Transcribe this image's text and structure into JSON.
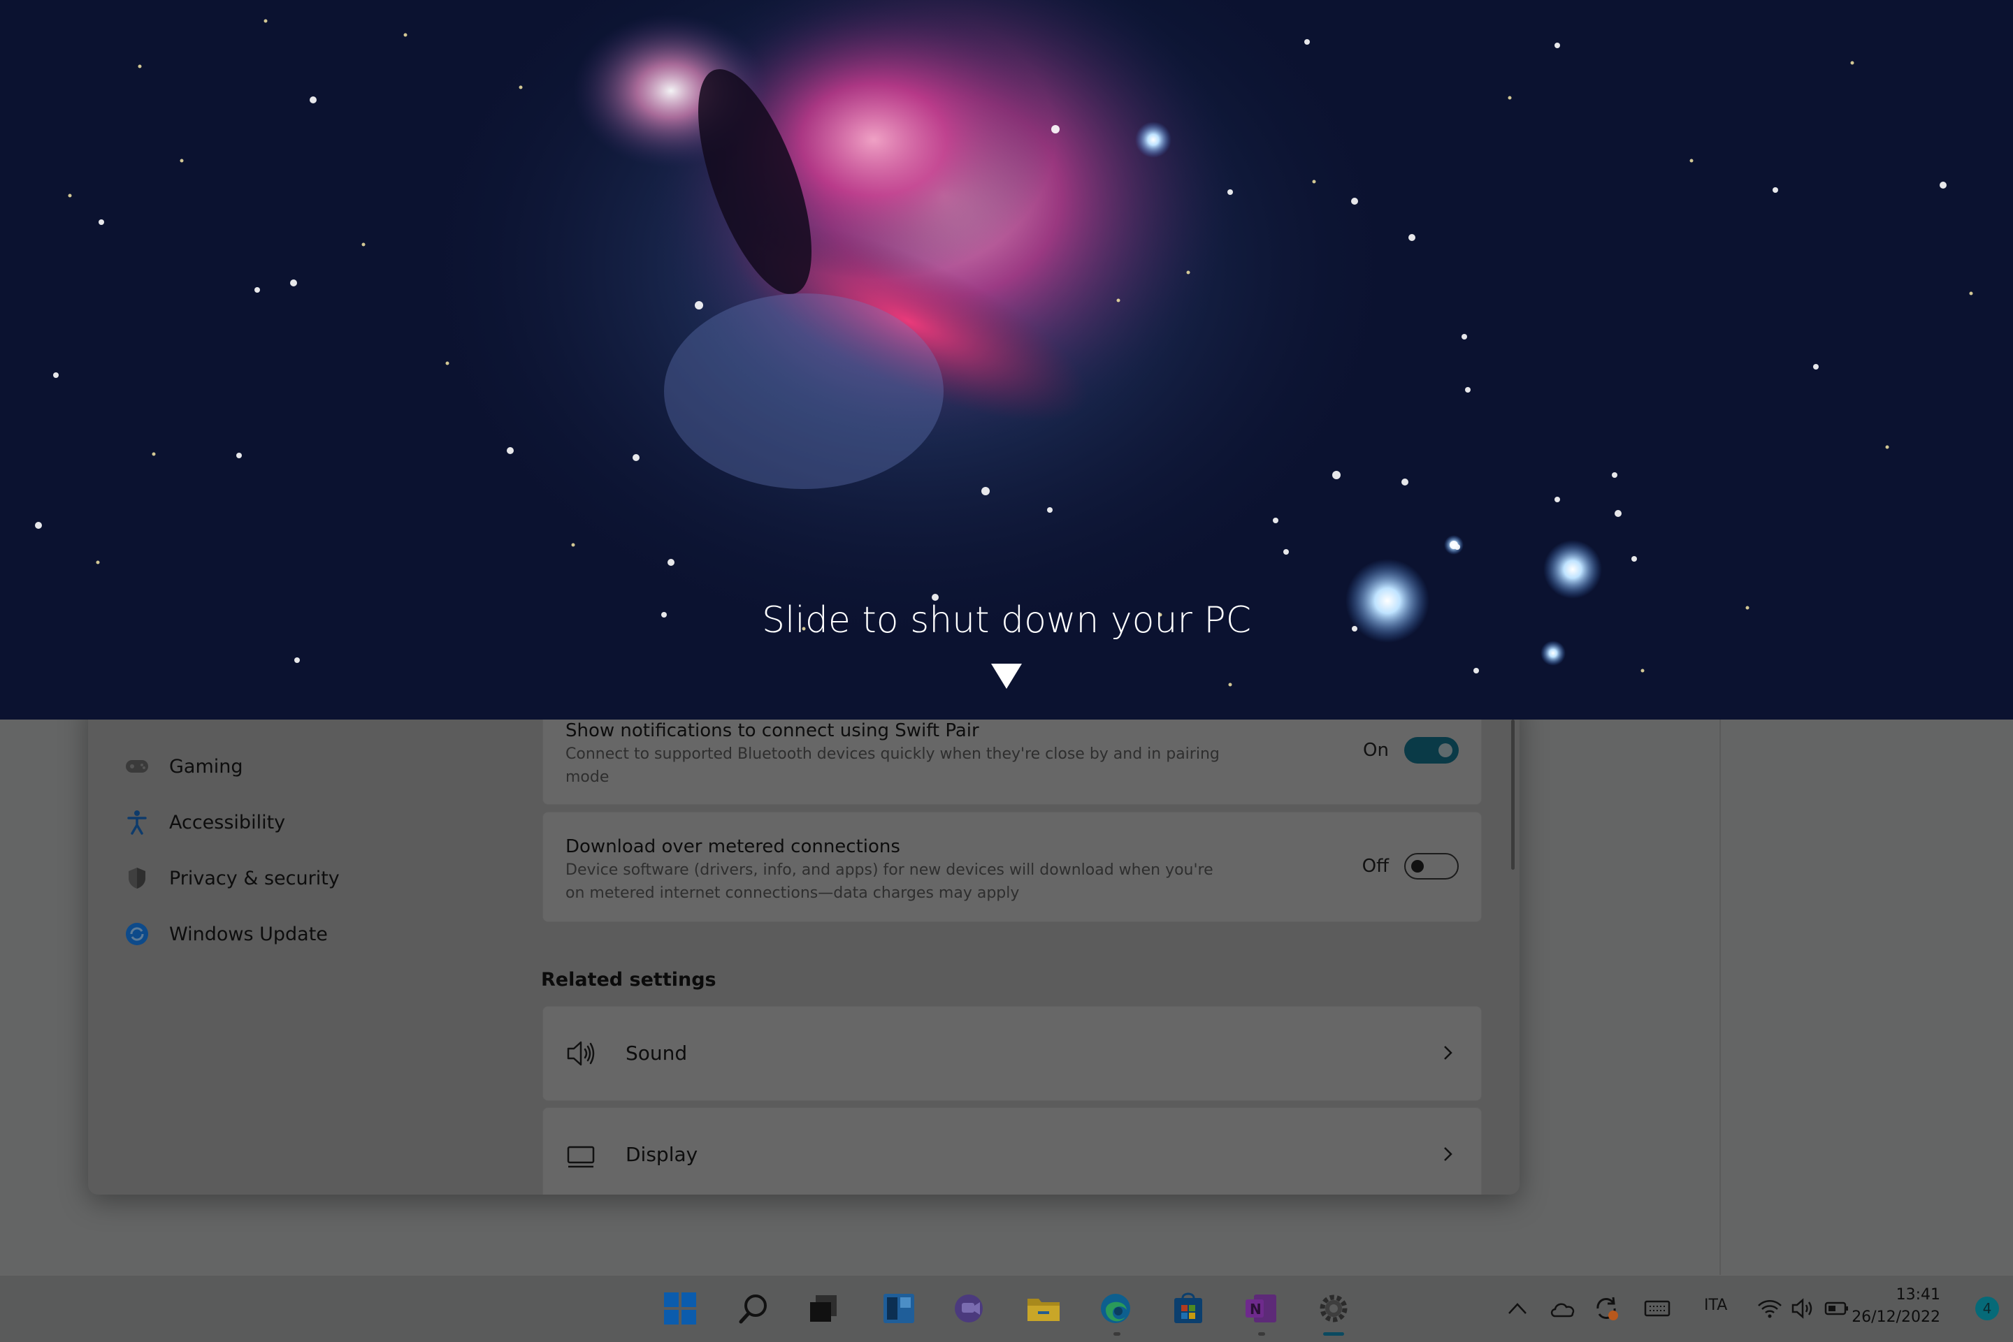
{
  "lock_overlay": {
    "message": "Slide to shut down your PC"
  },
  "settings": {
    "nav_items": [
      {
        "label": "Gaming",
        "icon": "gaming-icon"
      },
      {
        "label": "Accessibility",
        "icon": "accessibility-icon"
      },
      {
        "label": "Privacy & security",
        "icon": "shield-icon"
      },
      {
        "label": "Windows Update",
        "icon": "windows-update-icon"
      }
    ],
    "swift_pair": {
      "title": "Show notifications to connect using Swift Pair",
      "desc_line1": "Connect to supported Bluetooth devices quickly when they're close by and in pairing",
      "desc_line2": "mode",
      "state_label": "On",
      "state": true
    },
    "metered": {
      "title": "Download over metered connections",
      "desc_line1": "Device software (drivers, info, and apps) for new devices will download when you're",
      "desc_line2": "on metered internet connections—data charges may apply",
      "state_label": "Off",
      "state": false
    },
    "related_heading": "Related settings",
    "related": [
      {
        "label": "Sound",
        "icon": "speaker-icon"
      },
      {
        "label": "Display",
        "icon": "monitor-icon"
      }
    ]
  },
  "taskbar": {
    "apps": [
      "start-icon",
      "search-icon",
      "task-view-icon",
      "widgets-icon",
      "chat-icon",
      "file-explorer-icon",
      "edge-icon",
      "store-icon",
      "onenote-icon",
      "settings-icon"
    ],
    "tray": {
      "language": "ITA",
      "time": "13:41",
      "date": "26/12/2022",
      "notifications": "4"
    }
  },
  "colors": {
    "toggle_on": "#0a3a47",
    "accent_blue": "#1565c0",
    "badge": "#066a78"
  }
}
